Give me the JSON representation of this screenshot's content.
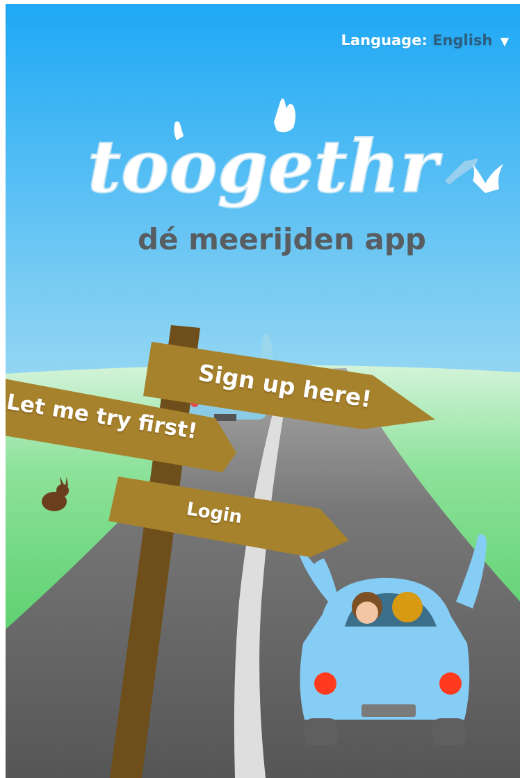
{
  "language": {
    "label": "Language:",
    "value": "English",
    "caret": "▼"
  },
  "brand": {
    "logo_text": "toogethr",
    "tagline": "dé meerijden app"
  },
  "signs": {
    "signup": "Sign up here!",
    "try_first": "Let me try first!",
    "login": "Login"
  },
  "colors": {
    "sky_top": "#22a9f5",
    "sky_bottom": "#bfe3f2",
    "grass": "#34c34a",
    "road": "#6d6d6d",
    "sign_wood": "#a7822c",
    "post_wood": "#6e4e1a",
    "car": "#86cdf5",
    "tail_light": "#ff3a1f"
  }
}
